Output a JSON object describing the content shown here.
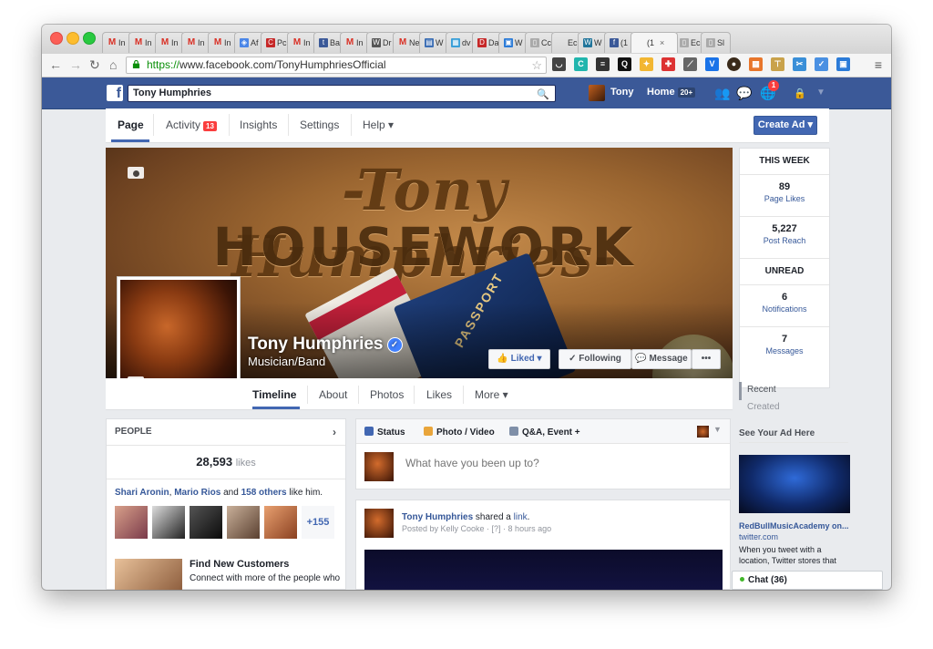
{
  "browser": {
    "tabs": [
      {
        "icon": "gmail-icon",
        "label": "In"
      },
      {
        "icon": "gmail-icon",
        "label": "In"
      },
      {
        "icon": "gmail-icon",
        "label": "In"
      },
      {
        "icon": "gmail-icon",
        "label": "In"
      },
      {
        "icon": "gmail-icon",
        "label": "In"
      },
      {
        "icon": "shield-icon",
        "label": "Af"
      },
      {
        "icon": "c-icon",
        "label": "Pc"
      },
      {
        "icon": "gmail-icon",
        "label": "In"
      },
      {
        "icon": "t-icon",
        "label": "Ba"
      },
      {
        "icon": "gmail-icon",
        "label": "In"
      },
      {
        "icon": "wikipedia-icon",
        "label": "Dr"
      },
      {
        "icon": "gmail-icon",
        "label": "Ne"
      },
      {
        "icon": "bus-icon",
        "label": "W"
      },
      {
        "icon": "grid-icon",
        "label": "dv"
      },
      {
        "icon": "dvd-icon",
        "label": "Da"
      },
      {
        "icon": "doc-icon",
        "label": "W"
      },
      {
        "icon": "page-icon",
        "label": "Cc"
      },
      {
        "icon": "blank-icon",
        "label": "Ec"
      },
      {
        "icon": "wordpress-icon",
        "label": "W"
      },
      {
        "icon": "facebook-icon",
        "label": "(1"
      },
      {
        "icon": "blank-icon",
        "label": "(1",
        "active": true
      },
      {
        "icon": "page-icon",
        "label": "Ec"
      },
      {
        "icon": "page-icon",
        "label": "Sl"
      }
    ],
    "active_tab_close": "×",
    "url_scheme": "https://",
    "url_rest": "www.facebook.com/TonyHumphriesOfficial"
  },
  "fb_header": {
    "logo": "f",
    "search_value": "Tony Humphries",
    "user_name": "Tony",
    "home_label": "Home",
    "home_badge": "20+",
    "notifications_badge": "1"
  },
  "admin_bar": {
    "page_label": "Page",
    "activity_label": "Activity",
    "activity_badge": "13",
    "insights_label": "Insights",
    "settings_label": "Settings",
    "help_label": "Help ▾",
    "create_ad_label": "Create Ad ▾"
  },
  "cover": {
    "script_text": "-Tony Humphries-",
    "block_text": "HOUSEWORK",
    "passport_text": "PASSPORT",
    "page_name": "Tony Humphries",
    "category": "Musician/Band",
    "liked_label": "Liked ▾",
    "following_label": "✓ Following",
    "message_label": "Message",
    "more_dots": "•••"
  },
  "cover_tabs": {
    "timeline": "Timeline",
    "about": "About",
    "photos": "Photos",
    "likes": "Likes",
    "more": "More ▾"
  },
  "right_col": {
    "this_week": "THIS WEEK",
    "page_likes_num": "89",
    "page_likes_lbl": "Page Likes",
    "post_reach_num": "5,227",
    "post_reach_lbl": "Post Reach",
    "unread": "UNREAD",
    "notifications_num": "6",
    "notifications_lbl": "Notifications",
    "messages_num": "7",
    "messages_lbl": "Messages",
    "recent": "Recent",
    "created": "Created",
    "ad_header": "See Your Ad Here",
    "ad_title": "RedBullMusicAcademy on...",
    "ad_domain": "twitter.com",
    "ad_text": "When you tweet with a location, Twitter stores that",
    "chat_label": "Chat (36)"
  },
  "people": {
    "header": "PEOPLE",
    "likes_count": "28,593",
    "likes_word": "likes",
    "friend1": "Shari Aronin",
    "sep1": ", ",
    "friend2": "Mario Rios",
    "and_text": " and ",
    "others": "158 others",
    "like_him": " like him.",
    "more_count": "+155",
    "fnc_title": "Find New Customers",
    "fnc_text": "Connect with more of the people who"
  },
  "composer": {
    "status": "Status",
    "photo_video": "Photo / Video",
    "qa_event": "Q&A, Event +",
    "placeholder": "What have you been up to?"
  },
  "post": {
    "author": "Tony Humphries",
    "shared": " shared a ",
    "link": "link",
    "dot": ".",
    "meta": "Posted by Kelly Cooke · [?] · 8 hours ago"
  },
  "colors": {
    "fb_blue": "#3b5998",
    "accent": "#4267b2",
    "link": "#365899",
    "badge_red": "#fa3e3e"
  }
}
